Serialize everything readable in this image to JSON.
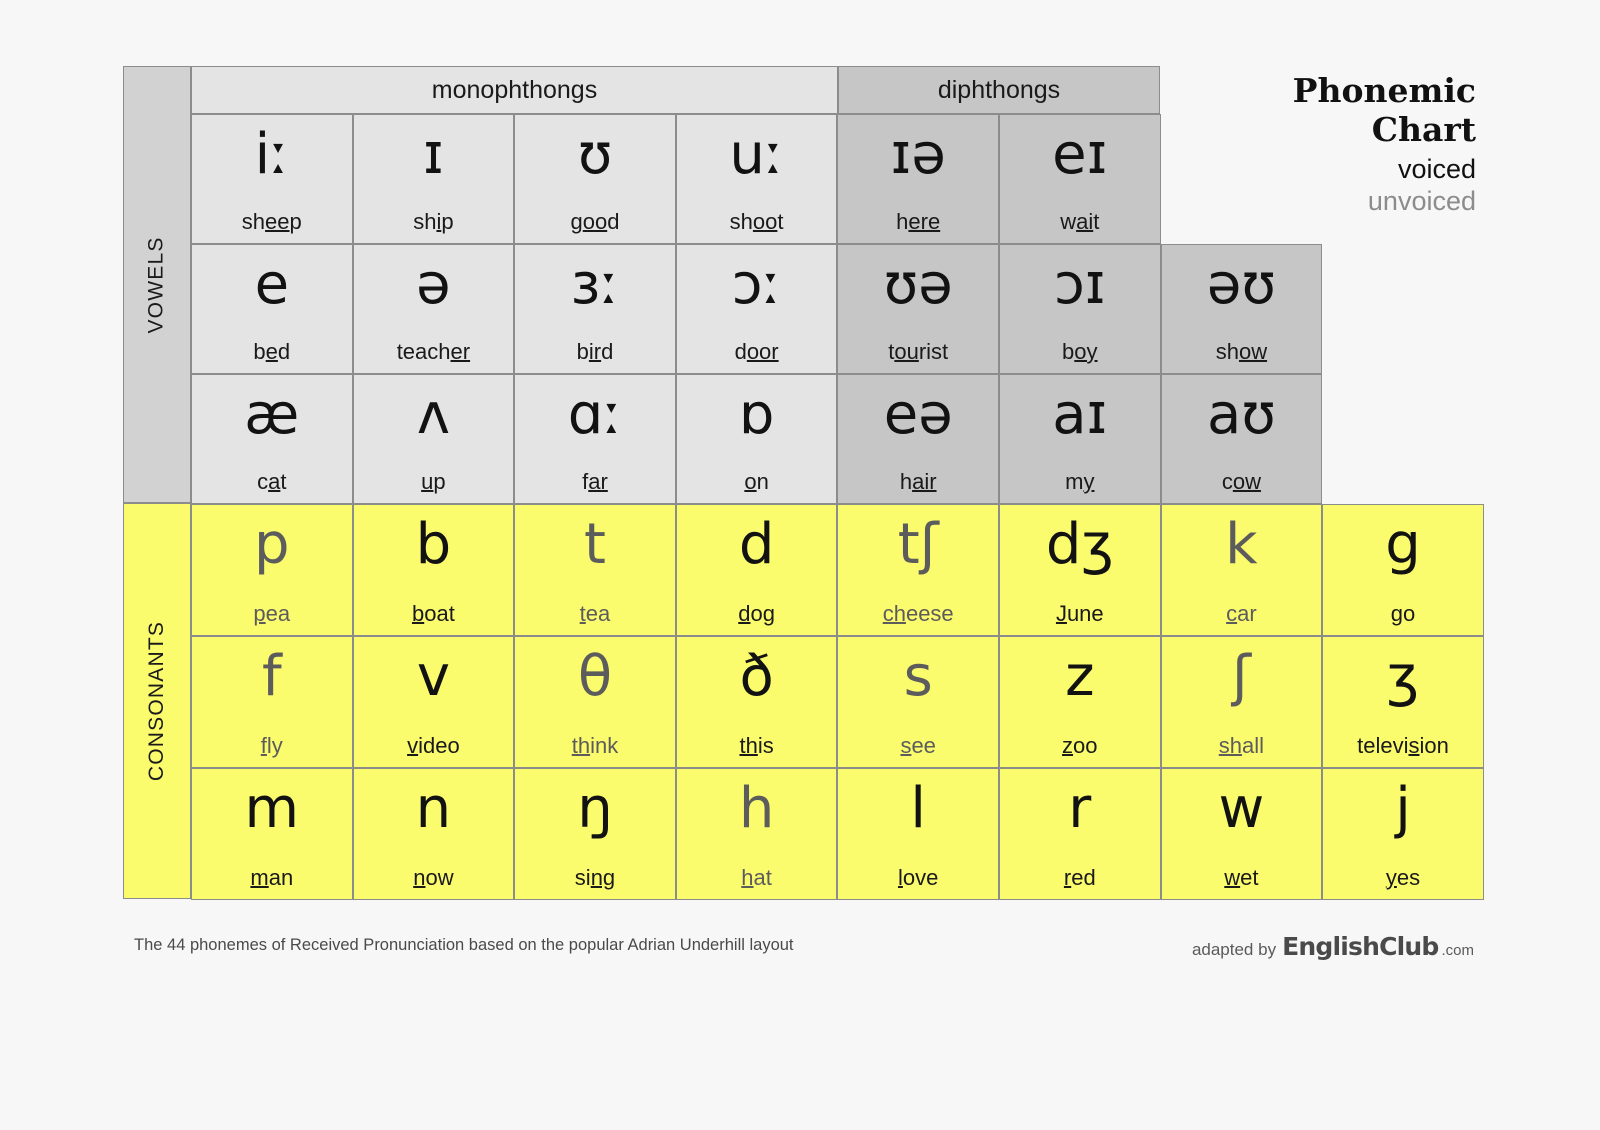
{
  "title": {
    "line1": "Phonemic",
    "line2": "Chart",
    "voiced_label": "voiced",
    "unvoiced_label": "unvoiced"
  },
  "sections": {
    "vowels_label": "VOWELS",
    "consonants_label": "CONSONANTS",
    "monophthongs_label": "monophthongs",
    "diphthongs_label": "diphthongs"
  },
  "colors": {
    "page_bg": "#f7f7f7",
    "monophthong_bg": "#e4e4e4",
    "diphthong_bg": "#c6c6c6",
    "consonant_bg": "#fbfb6e",
    "spine_vowel_bg": "#d2d2d2",
    "grid_line": "#8c8c8c",
    "voiced_text": "#121212",
    "unvoiced_text": "#5c5c5c"
  },
  "footer": {
    "note": "The 44 phonemes of Received Pronunciation based on the popular Adrian Underhill layout",
    "credit_prefix": "adapted by",
    "brand": "EnglishClub",
    "brand_tld": ".com"
  },
  "chart_data": {
    "type": "table",
    "title": "Phonemic Chart",
    "rows": [
      {
        "group": "vowels",
        "cells": [
          {
            "symbol": "iː",
            "word": "sheep",
            "before": "sh",
            "underlined": "ee",
            "after": "p",
            "kind": "monophthong",
            "voiced": true
          },
          {
            "symbol": "ɪ",
            "word": "ship",
            "before": "sh",
            "underlined": "i",
            "after": "p",
            "kind": "monophthong",
            "voiced": true
          },
          {
            "symbol": "ʊ",
            "word": "good",
            "before": "g",
            "underlined": "oo",
            "after": "d",
            "kind": "monophthong",
            "voiced": true
          },
          {
            "symbol": "uː",
            "word": "shoot",
            "before": "sh",
            "underlined": "oo",
            "after": "t",
            "kind": "monophthong",
            "voiced": true
          },
          {
            "symbol": "ɪə",
            "word": "here",
            "before": "h",
            "underlined": "ere",
            "after": "",
            "kind": "diphthong",
            "voiced": true
          },
          {
            "symbol": "eɪ",
            "word": "wait",
            "before": "w",
            "underlined": "ai",
            "after": "t",
            "kind": "diphthong",
            "voiced": true
          }
        ]
      },
      {
        "group": "vowels",
        "cells": [
          {
            "symbol": "e",
            "word": "bed",
            "before": "b",
            "underlined": "e",
            "after": "d",
            "kind": "monophthong",
            "voiced": true
          },
          {
            "symbol": "ə",
            "word": "teacher",
            "before": "teach",
            "underlined": "er",
            "after": "",
            "kind": "monophthong",
            "voiced": true
          },
          {
            "symbol": "ɜː",
            "word": "bird",
            "before": "b",
            "underlined": "ir",
            "after": "d",
            "kind": "monophthong",
            "voiced": true
          },
          {
            "symbol": "ɔː",
            "word": "door",
            "before": "d",
            "underlined": "oor",
            "after": "",
            "kind": "monophthong",
            "voiced": true
          },
          {
            "symbol": "ʊə",
            "word": "tourist",
            "before": "t",
            "underlined": "ou",
            "after": "rist",
            "kind": "diphthong",
            "voiced": true
          },
          {
            "symbol": "ɔɪ",
            "word": "boy",
            "before": "b",
            "underlined": "oy",
            "after": "",
            "kind": "diphthong",
            "voiced": true
          },
          {
            "symbol": "əʊ",
            "word": "show",
            "before": "sh",
            "underlined": "ow",
            "after": "",
            "kind": "diphthong",
            "voiced": true
          }
        ]
      },
      {
        "group": "vowels",
        "cells": [
          {
            "symbol": "æ",
            "word": "cat",
            "before": "c",
            "underlined": "a",
            "after": "t",
            "kind": "monophthong",
            "voiced": true
          },
          {
            "symbol": "ʌ",
            "word": "up",
            "before": "",
            "underlined": "u",
            "after": "p",
            "kind": "monophthong",
            "voiced": true
          },
          {
            "symbol": "ɑː",
            "word": "far",
            "before": "f",
            "underlined": "ar",
            "after": "",
            "kind": "monophthong",
            "voiced": true
          },
          {
            "symbol": "ɒ",
            "word": "on",
            "before": "",
            "underlined": "o",
            "after": "n",
            "kind": "monophthong",
            "voiced": true
          },
          {
            "symbol": "eə",
            "word": "hair",
            "before": "h",
            "underlined": "air",
            "after": "",
            "kind": "diphthong",
            "voiced": true
          },
          {
            "symbol": "aɪ",
            "word": "my",
            "before": "m",
            "underlined": "y",
            "after": "",
            "kind": "diphthong",
            "voiced": true
          },
          {
            "symbol": "aʊ",
            "word": "cow",
            "before": "c",
            "underlined": "ow",
            "after": "",
            "kind": "diphthong",
            "voiced": true
          }
        ]
      },
      {
        "group": "consonants",
        "cells": [
          {
            "symbol": "p",
            "word": "pea",
            "before": "",
            "underlined": "p",
            "after": "ea",
            "kind": "consonant",
            "voiced": false
          },
          {
            "symbol": "b",
            "word": "boat",
            "before": "",
            "underlined": "b",
            "after": "oat",
            "kind": "consonant",
            "voiced": true
          },
          {
            "symbol": "t",
            "word": "tea",
            "before": "",
            "underlined": "t",
            "after": "ea",
            "kind": "consonant",
            "voiced": false
          },
          {
            "symbol": "d",
            "word": "dog",
            "before": "",
            "underlined": "d",
            "after": "og",
            "kind": "consonant",
            "voiced": true
          },
          {
            "symbol": "tʃ",
            "word": "cheese",
            "before": "",
            "underlined": "ch",
            "after": "eese",
            "kind": "consonant",
            "voiced": false
          },
          {
            "symbol": "dʒ",
            "word": "June",
            "before": "",
            "underlined": "J",
            "after": "une",
            "kind": "consonant",
            "voiced": true
          },
          {
            "symbol": "k",
            "word": "car",
            "before": "",
            "underlined": "c",
            "after": "ar",
            "kind": "consonant",
            "voiced": false
          },
          {
            "symbol": "g",
            "word": "go",
            "before": "",
            "underlined": "g",
            "after": "o",
            "kind": "consonant",
            "voiced": true
          }
        ]
      },
      {
        "group": "consonants",
        "cells": [
          {
            "symbol": "f",
            "word": "fly",
            "before": "",
            "underlined": "f",
            "after": "ly",
            "kind": "consonant",
            "voiced": false
          },
          {
            "symbol": "v",
            "word": "video",
            "before": "",
            "underlined": "v",
            "after": "ideo",
            "kind": "consonant",
            "voiced": true
          },
          {
            "symbol": "θ",
            "word": "think",
            "before": "",
            "underlined": "th",
            "after": "ink",
            "kind": "consonant",
            "voiced": false
          },
          {
            "symbol": "ð",
            "word": "this",
            "before": "",
            "underlined": "th",
            "after": "is",
            "kind": "consonant",
            "voiced": true
          },
          {
            "symbol": "s",
            "word": "see",
            "before": "",
            "underlined": "s",
            "after": "ee",
            "kind": "consonant",
            "voiced": false
          },
          {
            "symbol": "z",
            "word": "zoo",
            "before": "",
            "underlined": "z",
            "after": "oo",
            "kind": "consonant",
            "voiced": true
          },
          {
            "symbol": "ʃ",
            "word": "shall",
            "before": "",
            "underlined": "sh",
            "after": "all",
            "kind": "consonant",
            "voiced": false
          },
          {
            "symbol": "ʒ",
            "word": "television",
            "before": "televi",
            "underlined": "s",
            "after": "ion",
            "kind": "consonant",
            "voiced": true
          }
        ]
      },
      {
        "group": "consonants",
        "cells": [
          {
            "symbol": "m",
            "word": "man",
            "before": "",
            "underlined": "m",
            "after": "an",
            "kind": "consonant",
            "voiced": true
          },
          {
            "symbol": "n",
            "word": "now",
            "before": "",
            "underlined": "n",
            "after": "ow",
            "kind": "consonant",
            "voiced": true
          },
          {
            "symbol": "ŋ",
            "word": "sing",
            "before": "si",
            "underlined": "ng",
            "after": "",
            "kind": "consonant",
            "voiced": true
          },
          {
            "symbol": "h",
            "word": "hat",
            "before": "",
            "underlined": "h",
            "after": "at",
            "kind": "consonant",
            "voiced": false
          },
          {
            "symbol": "l",
            "word": "love",
            "before": "",
            "underlined": "l",
            "after": "ove",
            "kind": "consonant",
            "voiced": true
          },
          {
            "symbol": "r",
            "word": "red",
            "before": "",
            "underlined": "r",
            "after": "ed",
            "kind": "consonant",
            "voiced": true
          },
          {
            "symbol": "w",
            "word": "wet",
            "before": "",
            "underlined": "w",
            "after": "et",
            "kind": "consonant",
            "voiced": true
          },
          {
            "symbol": "j",
            "word": "yes",
            "before": "",
            "underlined": "y",
            "after": "es",
            "kind": "consonant",
            "voiced": true
          }
        ]
      }
    ]
  }
}
